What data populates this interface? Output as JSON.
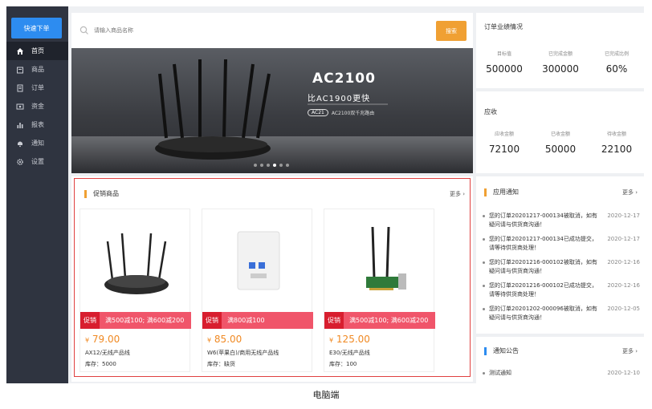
{
  "sidebar": {
    "quick_order": "快速下单",
    "items": [
      {
        "label": "首页",
        "icon": "home-icon"
      },
      {
        "label": "商品",
        "icon": "goods-icon"
      },
      {
        "label": "订单",
        "icon": "order-icon"
      },
      {
        "label": "资金",
        "icon": "funds-icon"
      },
      {
        "label": "报表",
        "icon": "chart-icon"
      },
      {
        "label": "通知",
        "icon": "bell-icon"
      },
      {
        "label": "设置",
        "icon": "gear-icon"
      }
    ]
  },
  "search": {
    "placeholder": "请输入商品名称",
    "button": "搜索"
  },
  "banner": {
    "title": "AC2100",
    "subtitle": "比AC1900更快",
    "badge": "AC21",
    "tagline": "AC2100双千兆路由",
    "dots": 6,
    "active_dot": 4
  },
  "promo": {
    "title": "促销商品",
    "more": "更多",
    "products": [
      {
        "tag": "促销",
        "offer": "满500减100; 满600减200",
        "price_symbol": "¥",
        "price": "79.00",
        "name": "AX12/无线产品线",
        "stock": "库存：5000"
      },
      {
        "tag": "促销",
        "offer": "满800减100",
        "price_symbol": "¥",
        "price": "85.00",
        "name": "W6(苹果白)/商用无线产品线",
        "stock": "库存：缺货"
      },
      {
        "tag": "促销",
        "offer": "满500减100; 满600减200",
        "price_symbol": "¥",
        "price": "125.00",
        "name": "E30/无线产品线",
        "stock": "库存：100"
      }
    ]
  },
  "order_perf": {
    "title": "订单业绩情况",
    "items": [
      {
        "label": "目标值",
        "value": "500000"
      },
      {
        "label": "已完成金额",
        "value": "300000"
      },
      {
        "label": "已完成比例",
        "value": "60%"
      }
    ]
  },
  "receivable": {
    "title": "应收",
    "items": [
      {
        "label": "应收金额",
        "value": "72100"
      },
      {
        "label": "已收金额",
        "value": "50000"
      },
      {
        "label": "待收金额",
        "value": "22100"
      }
    ]
  },
  "app_notice": {
    "title": "应用通知",
    "more": "更多",
    "items": [
      {
        "text": "您的订单20201217-000134被取消，如有疑问请与供货商沟通！",
        "date": "2020-12-17"
      },
      {
        "text": "您的订单20201217-000134已成功提交，请等待供货商处理！",
        "date": "2020-12-17"
      },
      {
        "text": "您的订单20201216-000102被取消，如有疑问请与供货商沟通！",
        "date": "2020-12-16"
      },
      {
        "text": "您的订单20201216-000102已成功提交，请等待供货商处理！",
        "date": "2020-12-16"
      },
      {
        "text": "您的订单20201202-000096被取消，如有疑问请与供货商沟通！",
        "date": "2020-12-05"
      }
    ]
  },
  "announce": {
    "title": "通知公告",
    "more": "更多",
    "items": [
      {
        "text": "测试通知",
        "date": "2020-12-10"
      }
    ]
  },
  "caption": "电脑端",
  "colors": {
    "accent": "#2d8cf0",
    "sidebar": "#2f3440",
    "promo_red": "#d81e2f",
    "price_orange": "#f08a24",
    "search_orange": "#f0a033"
  }
}
